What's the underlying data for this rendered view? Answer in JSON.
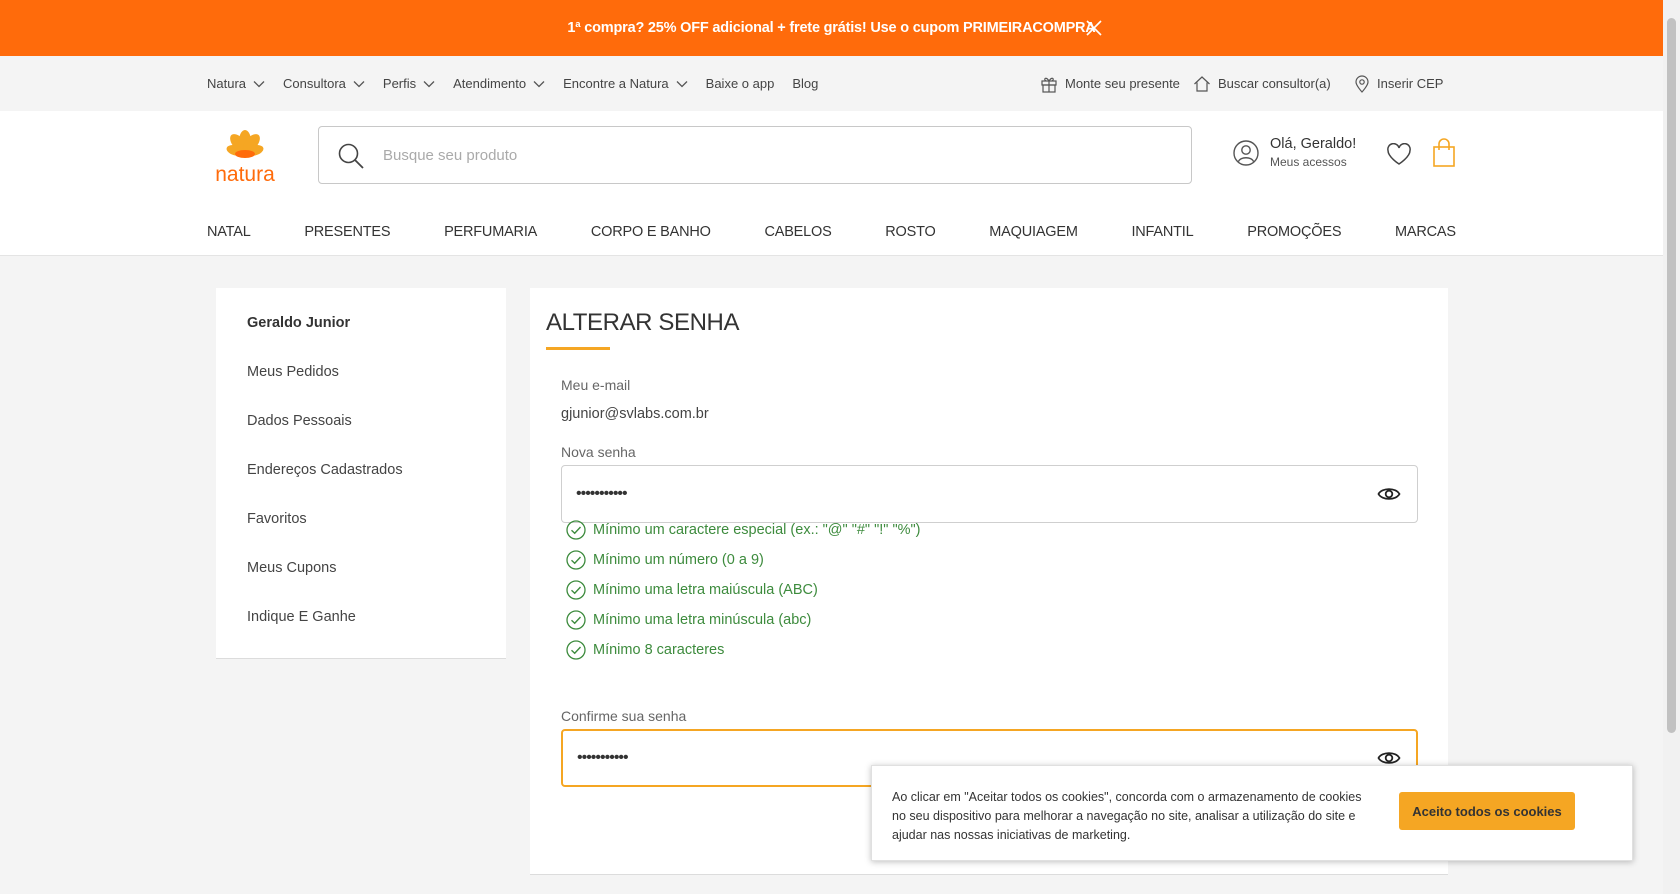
{
  "promo": {
    "text": "1ª compra? 25% OFF adicional + frete grátis! Use o cupom PRIMEIRACOMPRA"
  },
  "utility_nav": {
    "left": [
      {
        "label": "Natura",
        "dropdown": true
      },
      {
        "label": "Consultora",
        "dropdown": true
      },
      {
        "label": "Perfis",
        "dropdown": true
      },
      {
        "label": "Atendimento",
        "dropdown": true
      },
      {
        "label": "Encontre a Natura",
        "dropdown": true
      },
      {
        "label": "Baixe o app",
        "dropdown": false
      },
      {
        "label": "Blog",
        "dropdown": false
      }
    ],
    "right": {
      "gift": "Monte seu presente",
      "consultant": "Buscar consultor(a)",
      "cep": "Inserir CEP"
    }
  },
  "header": {
    "logo_text": "natura",
    "search_placeholder": "Busque seu produto",
    "account_greeting": "Olá, Geraldo!",
    "account_sub": "Meus acessos"
  },
  "categories": [
    "NATAL",
    "PRESENTES",
    "PERFUMARIA",
    "CORPO E BANHO",
    "CABELOS",
    "ROSTO",
    "MAQUIAGEM",
    "INFANTIL",
    "PROMOÇÕES",
    "MARCAS"
  ],
  "sidebar": {
    "user_name": "Geraldo Junior",
    "links": [
      "Meus Pedidos",
      "Dados Pessoais",
      "Endereços Cadastrados",
      "Favoritos",
      "Meus Cupons",
      "Indique E Ganhe"
    ]
  },
  "form": {
    "title": "ALTERAR SENHA",
    "email_label": "Meu e-mail",
    "email_value": "gjunior@svlabs.com.br",
    "new_password_label": "Nova senha",
    "new_password_value": "•••••••••••",
    "rules": [
      "Mínimo um caractere especial (ex.: \"@\" \"#\" \"!\" \"%\")",
      "Mínimo um número (0 a 9)",
      "Mínimo uma letra maiúscula (ABC)",
      "Mínimo uma letra minúscula (abc)",
      "Mínimo 8 caracteres"
    ],
    "confirm_label": "Confirme sua senha",
    "confirm_value": "•••••••••••"
  },
  "cookie": {
    "text": "Ao clicar em \"Aceitar todos os cookies\", concorda com o armazenamento de cookies no seu dispositivo para melhorar a navegação no site, analisar a utilização do site e ajudar nas nossas iniciativas de marketing.",
    "button": "Aceito todos os cookies"
  },
  "colors": {
    "promo_orange": "#ff6b0b",
    "accent": "#f5a623",
    "success_green": "#3d8b3d"
  }
}
